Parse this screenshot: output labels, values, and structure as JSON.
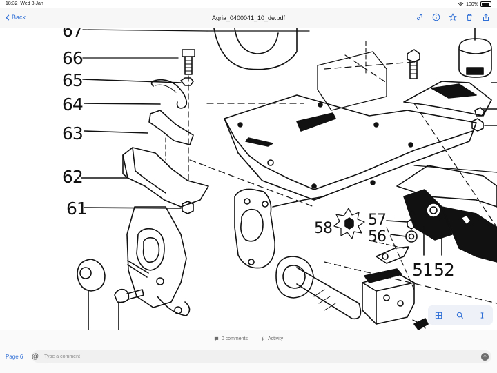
{
  "status_bar": {
    "time": "18:32",
    "date": "Wed 8 Jan",
    "battery": "100%"
  },
  "nav": {
    "back_label": "Back",
    "title": "Agria_0400041_10_de.pdf",
    "toolbar_icons": [
      "link-icon",
      "info-icon",
      "star-icon",
      "trash-icon",
      "share-icon"
    ]
  },
  "drawing": {
    "callouts": [
      "67",
      "66",
      "65",
      "64",
      "63",
      "62",
      "61",
      "58",
      "57",
      "56",
      "51",
      "52"
    ]
  },
  "floating_tools": [
    "grid-icon",
    "search-icon",
    "info-icon"
  ],
  "bottom": {
    "comments_label": "0 comments",
    "activity_label": "Activity",
    "page_label": "Page 6",
    "comment_placeholder": "Type a comment"
  }
}
